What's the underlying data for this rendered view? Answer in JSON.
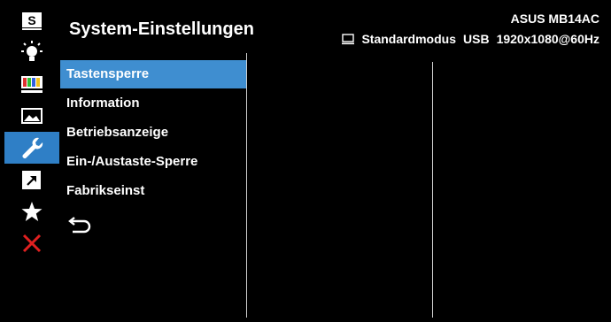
{
  "header": {
    "title": "System-Einstellungen",
    "model": "ASUS MB14AC",
    "mode": "Standardmodus",
    "input": "USB",
    "resolution": "1920x1080@60Hz"
  },
  "sidebar": {
    "items": [
      {
        "icon": "splendid-s-icon"
      },
      {
        "icon": "blue-light-filter-icon"
      },
      {
        "icon": "color-bars-icon"
      },
      {
        "icon": "image-icon"
      },
      {
        "icon": "wrench-icon",
        "active": true
      },
      {
        "icon": "shortcut-arrow-icon"
      },
      {
        "icon": "star-icon"
      },
      {
        "icon": "close-icon"
      }
    ]
  },
  "menu": {
    "items": [
      "Tastensperre",
      "Information",
      "Betriebsanzeige",
      "Ein-/Austaste-Sperre",
      "Fabrikseinst"
    ],
    "selected_index": 0
  },
  "colors": {
    "accent": "#2f7fc6",
    "selected": "#3f8ed0",
    "close": "#e02020",
    "background": "#000000"
  }
}
